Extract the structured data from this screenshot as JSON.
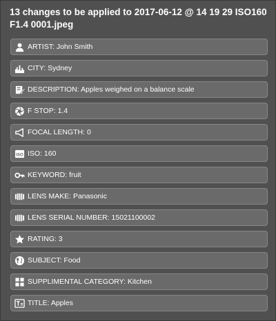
{
  "dialog": {
    "title": "13 changes to be applied to 2017-06-12 @ 14 19 29 ISO160 F1.4 0001.jpeg"
  },
  "changes": [
    {
      "icon": "person-icon",
      "label": "ARTIST: John Smith"
    },
    {
      "icon": "city-icon",
      "label": "CITY: Sydney"
    },
    {
      "icon": "edit-document-icon",
      "label": "DESCRIPTION: Apples weighed on a balance scale"
    },
    {
      "icon": "aperture-icon",
      "label": "F STOP: 1.4"
    },
    {
      "icon": "focal-length-icon",
      "label": "FOCAL LENGTH: 0"
    },
    {
      "icon": "iso-icon",
      "label": "ISO: 160"
    },
    {
      "icon": "key-icon",
      "label": "KEYWORD: fruit"
    },
    {
      "icon": "lens-icon",
      "label": "LENS MAKE: Panasonic"
    },
    {
      "icon": "lens-icon",
      "label": "LENS SERIAL NUMBER: 15021100002"
    },
    {
      "icon": "star-icon",
      "label": "RATING: 3"
    },
    {
      "icon": "subject-icon",
      "label": "SUBJECT: Food"
    },
    {
      "icon": "grid-category-icon",
      "label": "SUPPLIMENTAL CATEGORY: Kitchen"
    },
    {
      "icon": "title-icon",
      "label": "TITLE: Apples"
    }
  ]
}
